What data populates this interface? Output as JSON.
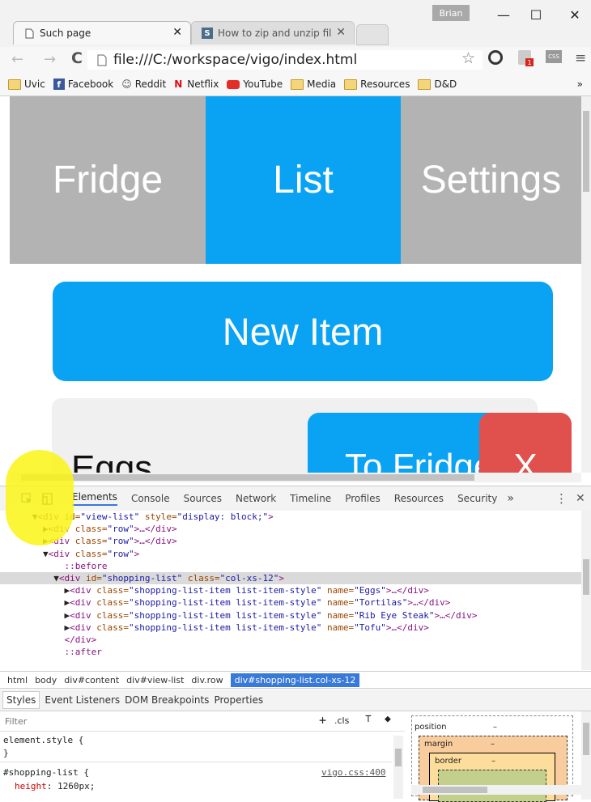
{
  "browser": {
    "user": "Brian",
    "tabs": [
      {
        "title": "Such page"
      },
      {
        "title": "How to zip and unzip files"
      }
    ],
    "address": "file:///C:/workspace/vigo/index.html",
    "bookmarks": [
      "Uvic",
      "Facebook",
      "Reddit",
      "Netflix",
      "YouTube",
      "Media",
      "Resources",
      "D&D"
    ],
    "overflow": "»"
  },
  "page": {
    "nav": [
      "Fridge",
      "List",
      "Settings"
    ],
    "new_item": "New Item",
    "item_name": "Eggs",
    "to_fridge": "To Fridge",
    "remove": "X"
  },
  "devtools": {
    "tabs": [
      "Elements",
      "Console",
      "Sources",
      "Network",
      "Timeline",
      "Profiles",
      "Resources",
      "Security"
    ],
    "more": "»",
    "dom_lines": [
      {
        "pre": "      ▼",
        "tag": "<div ",
        "a1": "id=",
        "v1": "\"view-list\"",
        "a2": " style=",
        "v2": "\"display: block;\"",
        "end": ">"
      },
      {
        "pre": "        ▶",
        "tag": "<div ",
        "a1": "class=",
        "v1": "\"row\"",
        "a2": "",
        "v2": "",
        "end": ">…</div>"
      },
      {
        "pre": "        ▶",
        "tag": "<div ",
        "a1": "class=",
        "v1": "\"row\"",
        "a2": "",
        "v2": "",
        "end": ">…</div>"
      },
      {
        "pre": "        ▼",
        "tag": "<div ",
        "a1": "class=",
        "v1": "\"row\"",
        "a2": "",
        "v2": "",
        "end": ">"
      },
      {
        "pre": "            ",
        "tag": "::before",
        "a1": "",
        "v1": "",
        "a2": "",
        "v2": "",
        "end": ""
      },
      {
        "pre": "          ▼",
        "tag": "<div ",
        "a1": "id=",
        "v1": "\"shopping-list\"",
        "a2": " class=",
        "v2": "\"col-xs-12\"",
        "end": ">"
      },
      {
        "pre": "            ▶",
        "tag": "<div ",
        "a1": "class=",
        "v1": "\"shopping-list-item list-item-style\"",
        "a2": " name=",
        "v2": "\"Eggs\"",
        "end": ">…</div>"
      },
      {
        "pre": "            ▶",
        "tag": "<div ",
        "a1": "class=",
        "v1": "\"shopping-list-item list-item-style\"",
        "a2": " name=",
        "v2": "\"Tortilas\"",
        "end": ">…</div>"
      },
      {
        "pre": "            ▶",
        "tag": "<div ",
        "a1": "class=",
        "v1": "\"shopping-list-item list-item-style\"",
        "a2": " name=",
        "v2": "\"Rib Eye Steak\"",
        "end": ">…</div>"
      },
      {
        "pre": "            ▶",
        "tag": "<div ",
        "a1": "class=",
        "v1": "\"shopping-list-item list-item-style\"",
        "a2": " name=",
        "v2": "\"Tofu\"",
        "end": ">…</div>"
      },
      {
        "pre": "            ",
        "tag": "</div>",
        "a1": "",
        "v1": "",
        "a2": "",
        "v2": "",
        "end": ""
      },
      {
        "pre": "            ",
        "tag": "::after",
        "a1": "",
        "v1": "",
        "a2": "",
        "v2": "",
        "end": ""
      }
    ],
    "breadcrumbs": [
      "html",
      "body",
      "div#content",
      "div#view-list",
      "div.row"
    ],
    "breadcrumb_active": "div#shopping-list.col-xs-12",
    "style_tabs": [
      "Styles",
      "Event Listeners",
      "DOM Breakpoints",
      "Properties"
    ],
    "filter_placeholder": "Filter",
    "cls_label": ".cls",
    "styles": {
      "rule1_selector": "element.style {",
      "rule1_close": "}",
      "rule2_selector": "#shopping-list {",
      "rule2_source": "vigo.css:400",
      "rule2_prop": "height",
      "rule2_value": "1260px;"
    },
    "box_model": {
      "position": "position",
      "margin": "margin",
      "border": "border",
      "dash": "–"
    }
  },
  "colors": {
    "accent": "#0aa3f3",
    "remove": "#e0504c",
    "nav_bg": "#b3b3b3",
    "highlight": "#faf514"
  }
}
